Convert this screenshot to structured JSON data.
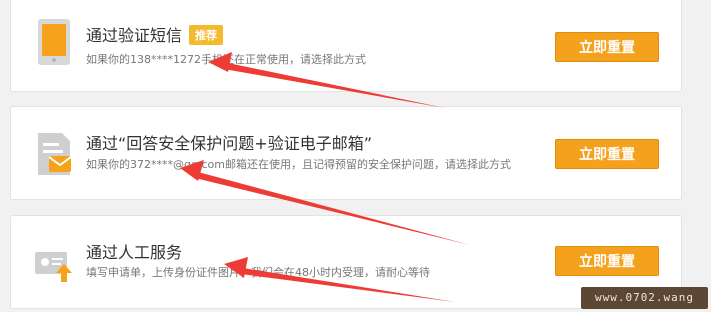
{
  "options": [
    {
      "title": "通过验证短信",
      "badge": "推荐",
      "description": "如果你的138****1272手机还在正常使用，请选择此方式",
      "button_label": "立即重置",
      "icon": "phone-icon"
    },
    {
      "title": "通过“回答安全保护问题+验证电子邮箱”",
      "description": "如果你的372****@qq.com邮箱还在使用，且记得预留的安全保护问题，请选择此方式",
      "button_label": "立即重置",
      "icon": "email-security-icon"
    },
    {
      "title": "通过人工服务",
      "description": "填写申请单，上传身份证件图片，我们会在48小时内受理，请耐心等待",
      "button_label": "立即重置",
      "icon": "id-card-upload-icon"
    }
  ],
  "watermark": "www.0702.wang",
  "colors": {
    "button": "#f4a21d",
    "badge": "#f5b92e",
    "arrow": "#ee3b35"
  }
}
